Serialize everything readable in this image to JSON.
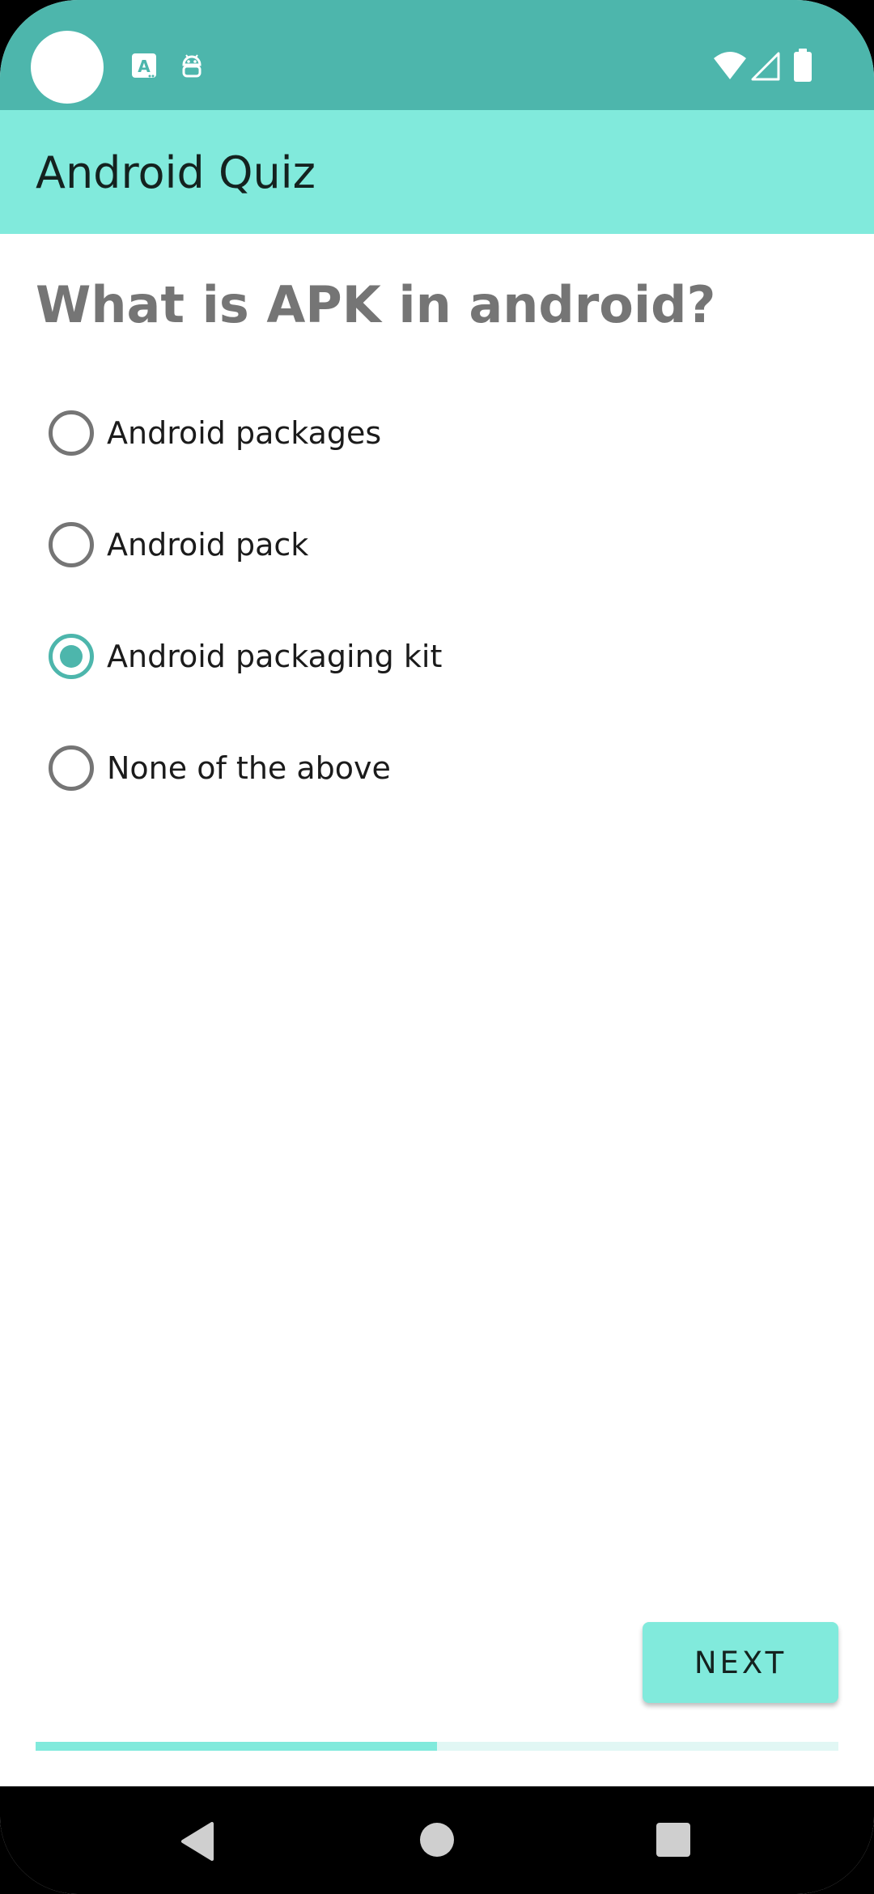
{
  "app": {
    "title": "Android Quiz"
  },
  "quiz": {
    "question": "What is APK in android?",
    "options": [
      {
        "label": "Android packages",
        "checked": false
      },
      {
        "label": "Android pack",
        "checked": false
      },
      {
        "label": "Android packaging kit",
        "checked": true
      },
      {
        "label": "None of the above",
        "checked": false
      }
    ],
    "next_label": "NEXT",
    "progress_fraction": 0.5
  },
  "colors": {
    "status_bar": "#4db6ac",
    "app_bar": "#81eadc",
    "accent": "#4db6ac",
    "progress_track": "#e1f7f4"
  },
  "icons": {
    "status": [
      "camera-hole",
      "translate-notification-icon",
      "android-notification-icon",
      "wifi-icon",
      "cellular-signal-icon",
      "battery-icon"
    ],
    "nav": [
      "back-icon",
      "home-icon",
      "recents-icon"
    ]
  }
}
